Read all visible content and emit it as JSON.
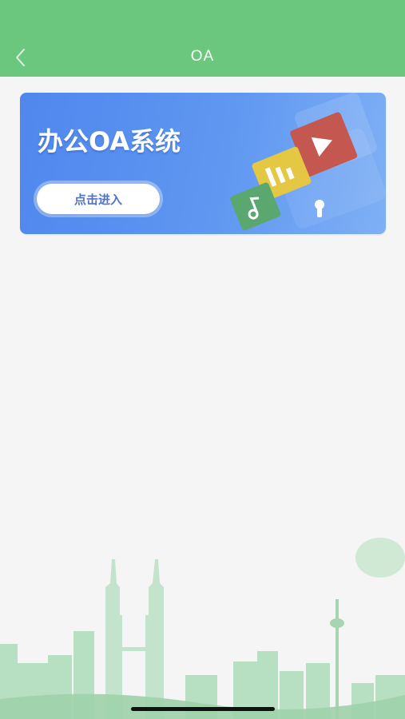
{
  "header": {
    "title": "OA",
    "back_icon": "chevron-left-icon",
    "background": "#6cc77e"
  },
  "banner": {
    "title": "办公OA系统",
    "button_label": "点击进入",
    "gradient_start": "#4f87ee",
    "gradient_end": "#7fb0f5"
  },
  "decoration": {
    "skyline_color": "#a8d6b3"
  }
}
